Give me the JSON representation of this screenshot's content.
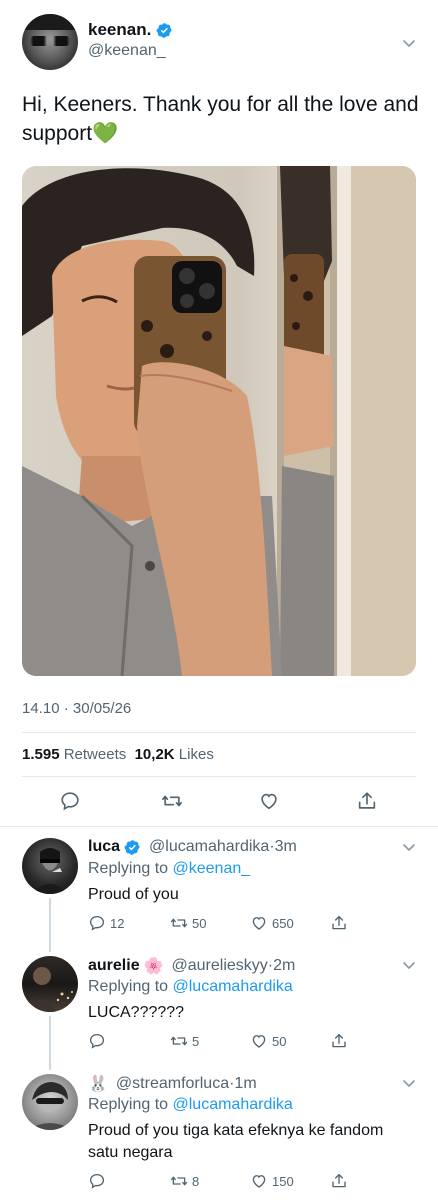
{
  "main_tweet": {
    "name": "keenan.",
    "handle": "@keenan_",
    "text": "Hi, Keeners. Thank you for all the love and support",
    "emoji": "💚",
    "time": "14.10",
    "date": "30/05/26",
    "retweets_count": "1.595",
    "retweets_label": "Retweets",
    "likes_count": "10,2K",
    "likes_label": "Likes"
  },
  "colors": {
    "link": "#1d9bf0",
    "muted": "#536471",
    "verified": "#1d9bf0"
  },
  "replies": [
    {
      "name": "luca",
      "handle": "@lucamahardika",
      "time": "3m",
      "replying_label": "Replying to",
      "replying_to": "@keenan_",
      "text": "Proud of you",
      "reply_count": "12",
      "retweet_count": "50",
      "like_count": "650"
    },
    {
      "name": "aurelie",
      "emoji": "🌸",
      "handle": "@aurelieskyy",
      "time": "2m",
      "replying_label": "Replying to",
      "replying_to": "@lucamahardika",
      "text": "LUCA??????",
      "reply_count": "",
      "retweet_count": "5",
      "like_count": "50"
    },
    {
      "name": "🐰",
      "handle": "@streamforluca",
      "time": "1m",
      "replying_label": "Replying to",
      "replying_to": "@lucamahardika",
      "text": "Proud of you tiga kata efeknya ke fandom satu negara",
      "reply_count": "",
      "retweet_count": "8",
      "like_count": "150"
    }
  ],
  "separator": "·"
}
